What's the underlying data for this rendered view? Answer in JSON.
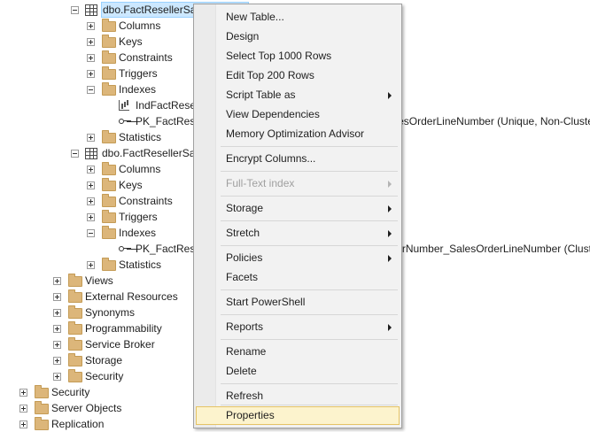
{
  "tree": {
    "table1": "dbo.FactResellerSalesXL_CCI",
    "table2": "dbo.FactResellerSalesXL_PageCompressed",
    "columns": "Columns",
    "keys": "Keys",
    "constraints": "Constraints",
    "triggers": "Triggers",
    "indexes": "Indexes",
    "statistics": "Statistics",
    "index1": "IndFactResellerSalesXL_CCI (Clustered Columnstore)",
    "index2": "PK_FactResellerSalesXL_CCI_SalesOrderNumber_SalesOrderLineNumber (Unique, Non-Clustered)",
    "index3": "PK_FactResellerSalesXL_PageCompressed_SalesOrderNumber_SalesOrderLineNumber (Clustered)",
    "views": "Views",
    "external_resources": "External Resources",
    "synonyms": "Synonyms",
    "programmability": "Programmability",
    "service_broker": "Service Broker",
    "storage": "Storage",
    "security_db": "Security",
    "security": "Security",
    "server_objects": "Server Objects",
    "replication": "Replication"
  },
  "menu": {
    "new_table": "New Table...",
    "design": "Design",
    "select_top": "Select Top 1000 Rows",
    "edit_top": "Edit Top 200 Rows",
    "script_table_as": "Script Table as",
    "view_dependencies": "View Dependencies",
    "memory_optimization": "Memory Optimization Advisor",
    "encrypt_columns": "Encrypt Columns...",
    "fulltext_index": "Full-Text index",
    "storage": "Storage",
    "stretch": "Stretch",
    "policies": "Policies",
    "facets": "Facets",
    "start_powershell": "Start PowerShell",
    "reports": "Reports",
    "rename": "Rename",
    "delete": "Delete",
    "refresh": "Refresh",
    "properties": "Properties"
  }
}
